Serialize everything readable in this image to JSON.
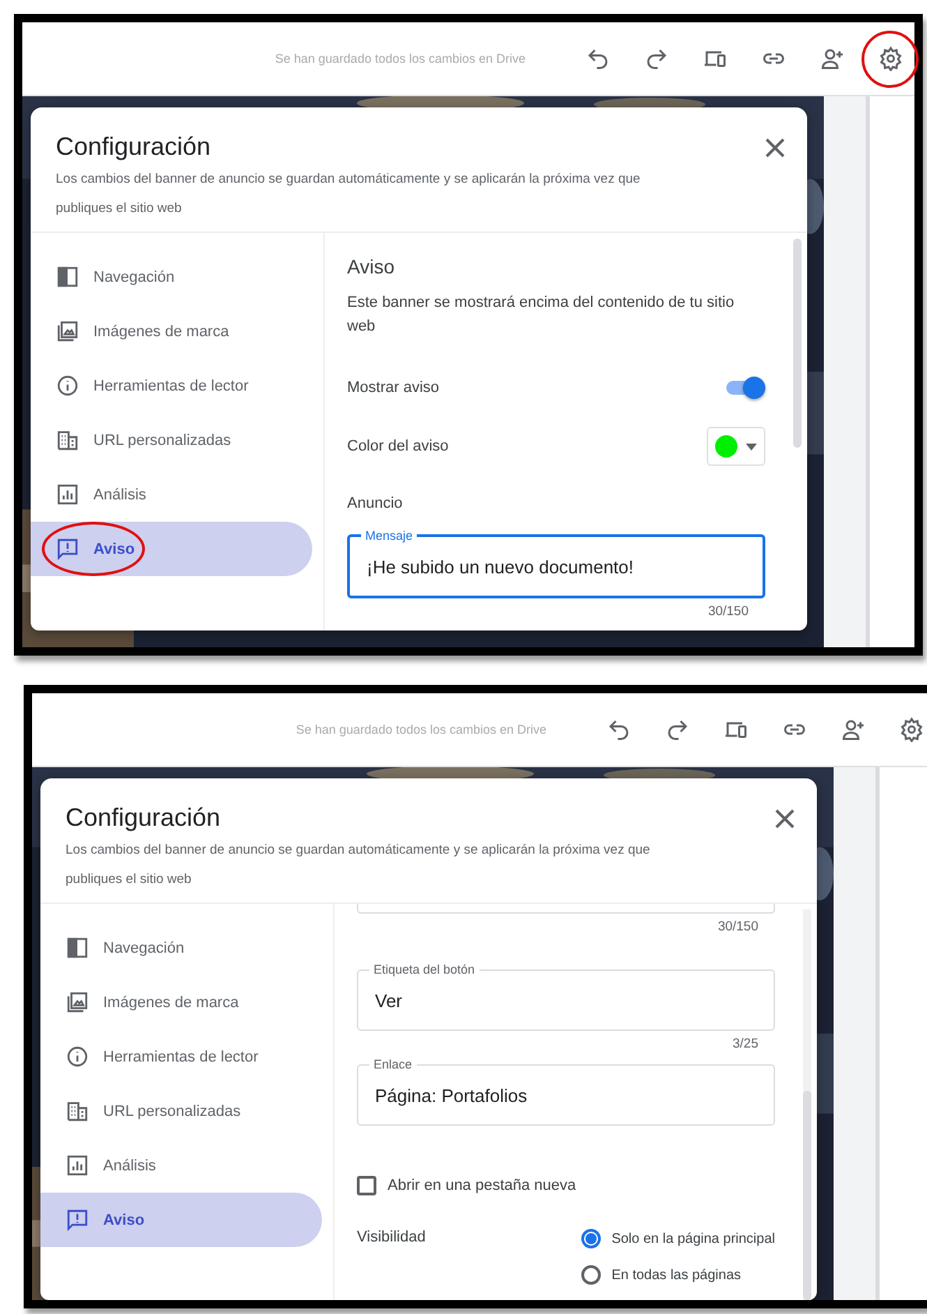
{
  "panels": [
    {
      "toolbar": {
        "status": "Se han guardado todos los cambios en Drive",
        "icons": [
          {
            "kind": "undo",
            "highlighted": false
          },
          {
            "kind": "redo",
            "highlighted": false
          },
          {
            "kind": "devices",
            "highlighted": false
          },
          {
            "kind": "link",
            "highlighted": false
          },
          {
            "kind": "add-person",
            "highlighted": false
          },
          {
            "kind": "settings",
            "highlighted": true
          }
        ]
      },
      "dialog": {
        "title": "Configuración",
        "subtitle": "Los cambios del banner de anuncio se guardan automáticamente y se aplicarán la próxima vez que publiques el sitio web",
        "scrolled": false,
        "sidebar": [
          {
            "kind": "navigation",
            "label": "Navegación",
            "selected": false,
            "highlighted": false
          },
          {
            "kind": "branding",
            "label": "Imágenes de marca",
            "selected": false,
            "highlighted": false
          },
          {
            "kind": "info",
            "label": "Herramientas de lector",
            "selected": false,
            "highlighted": false
          },
          {
            "kind": "url",
            "label": "URL personalizadas",
            "selected": false,
            "highlighted": false
          },
          {
            "kind": "analytics",
            "label": "Análisis",
            "selected": false,
            "highlighted": false
          },
          {
            "kind": "notice",
            "label": "Aviso",
            "selected": true,
            "highlighted": true
          }
        ],
        "content": [
          {
            "kind": "heading",
            "text": "Aviso"
          },
          {
            "kind": "paragraph",
            "text": "Este banner se mostrará encima del contenido de tu sitio web"
          },
          {
            "kind": "toggle",
            "label": "Mostrar aviso",
            "on": true
          },
          {
            "kind": "color",
            "label": "Color del aviso",
            "color": "#00ee00"
          },
          {
            "kind": "section",
            "text": "Anuncio"
          },
          {
            "kind": "field",
            "label": "Mensaje",
            "value": "¡He subido un nuevo documento!",
            "focused": true,
            "counter": "30/150"
          }
        ]
      }
    },
    {
      "toolbar": {
        "status": "Se han guardado todos los cambios en Drive",
        "icons": [
          {
            "kind": "undo",
            "highlighted": false
          },
          {
            "kind": "redo",
            "highlighted": false
          },
          {
            "kind": "devices",
            "highlighted": false
          },
          {
            "kind": "link",
            "highlighted": false
          },
          {
            "kind": "add-person",
            "highlighted": false
          },
          {
            "kind": "settings",
            "highlighted": false
          }
        ]
      },
      "dialog": {
        "title": "Configuración",
        "subtitle": "Los cambios del banner de anuncio se guardan automáticamente y se aplicarán la próxima vez que publiques el sitio web",
        "scrolled": true,
        "sidebar": [
          {
            "kind": "navigation",
            "label": "Navegación",
            "selected": false,
            "highlighted": false
          },
          {
            "kind": "branding",
            "label": "Imágenes de marca",
            "selected": false,
            "highlighted": false
          },
          {
            "kind": "info",
            "label": "Herramientas de lector",
            "selected": false,
            "highlighted": false
          },
          {
            "kind": "url",
            "label": "URL personalizadas",
            "selected": false,
            "highlighted": false
          },
          {
            "kind": "analytics",
            "label": "Análisis",
            "selected": false,
            "highlighted": false
          },
          {
            "kind": "notice",
            "label": "Aviso",
            "selected": true,
            "highlighted": false
          }
        ],
        "content": [
          {
            "kind": "field-end",
            "counter": "30/150"
          },
          {
            "kind": "field",
            "label": "Etiqueta del botón",
            "value": "Ver",
            "focused": false,
            "counter": "3/25"
          },
          {
            "kind": "field",
            "label": "Enlace",
            "value": "Página: Portafolios",
            "focused": false
          },
          {
            "kind": "checkbox",
            "label": "Abrir en una pestaña nueva",
            "checked": false
          },
          {
            "kind": "radio-group",
            "label": "Visibilidad",
            "options": [
              {
                "label": "Solo en la página principal",
                "selected": true
              },
              {
                "label": "En todas las páginas",
                "selected": false
              }
            ]
          }
        ]
      }
    }
  ]
}
